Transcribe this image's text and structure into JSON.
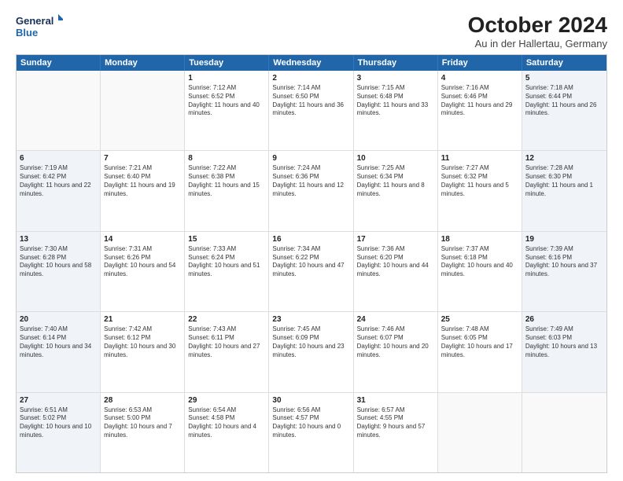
{
  "header": {
    "logo_line1": "General",
    "logo_line2": "Blue",
    "month_title": "October 2024",
    "location": "Au in der Hallertau, Germany"
  },
  "days_of_week": [
    "Sunday",
    "Monday",
    "Tuesday",
    "Wednesday",
    "Thursday",
    "Friday",
    "Saturday"
  ],
  "weeks": [
    [
      {
        "day": "",
        "info": "",
        "shaded": false,
        "empty": true
      },
      {
        "day": "",
        "info": "",
        "shaded": false,
        "empty": true
      },
      {
        "day": "1",
        "info": "Sunrise: 7:12 AM\nSunset: 6:52 PM\nDaylight: 11 hours and 40 minutes.",
        "shaded": false,
        "empty": false
      },
      {
        "day": "2",
        "info": "Sunrise: 7:14 AM\nSunset: 6:50 PM\nDaylight: 11 hours and 36 minutes.",
        "shaded": false,
        "empty": false
      },
      {
        "day": "3",
        "info": "Sunrise: 7:15 AM\nSunset: 6:48 PM\nDaylight: 11 hours and 33 minutes.",
        "shaded": false,
        "empty": false
      },
      {
        "day": "4",
        "info": "Sunrise: 7:16 AM\nSunset: 6:46 PM\nDaylight: 11 hours and 29 minutes.",
        "shaded": false,
        "empty": false
      },
      {
        "day": "5",
        "info": "Sunrise: 7:18 AM\nSunset: 6:44 PM\nDaylight: 11 hours and 26 minutes.",
        "shaded": true,
        "empty": false
      }
    ],
    [
      {
        "day": "6",
        "info": "Sunrise: 7:19 AM\nSunset: 6:42 PM\nDaylight: 11 hours and 22 minutes.",
        "shaded": true,
        "empty": false
      },
      {
        "day": "7",
        "info": "Sunrise: 7:21 AM\nSunset: 6:40 PM\nDaylight: 11 hours and 19 minutes.",
        "shaded": false,
        "empty": false
      },
      {
        "day": "8",
        "info": "Sunrise: 7:22 AM\nSunset: 6:38 PM\nDaylight: 11 hours and 15 minutes.",
        "shaded": false,
        "empty": false
      },
      {
        "day": "9",
        "info": "Sunrise: 7:24 AM\nSunset: 6:36 PM\nDaylight: 11 hours and 12 minutes.",
        "shaded": false,
        "empty": false
      },
      {
        "day": "10",
        "info": "Sunrise: 7:25 AM\nSunset: 6:34 PM\nDaylight: 11 hours and 8 minutes.",
        "shaded": false,
        "empty": false
      },
      {
        "day": "11",
        "info": "Sunrise: 7:27 AM\nSunset: 6:32 PM\nDaylight: 11 hours and 5 minutes.",
        "shaded": false,
        "empty": false
      },
      {
        "day": "12",
        "info": "Sunrise: 7:28 AM\nSunset: 6:30 PM\nDaylight: 11 hours and 1 minute.",
        "shaded": true,
        "empty": false
      }
    ],
    [
      {
        "day": "13",
        "info": "Sunrise: 7:30 AM\nSunset: 6:28 PM\nDaylight: 10 hours and 58 minutes.",
        "shaded": true,
        "empty": false
      },
      {
        "day": "14",
        "info": "Sunrise: 7:31 AM\nSunset: 6:26 PM\nDaylight: 10 hours and 54 minutes.",
        "shaded": false,
        "empty": false
      },
      {
        "day": "15",
        "info": "Sunrise: 7:33 AM\nSunset: 6:24 PM\nDaylight: 10 hours and 51 minutes.",
        "shaded": false,
        "empty": false
      },
      {
        "day": "16",
        "info": "Sunrise: 7:34 AM\nSunset: 6:22 PM\nDaylight: 10 hours and 47 minutes.",
        "shaded": false,
        "empty": false
      },
      {
        "day": "17",
        "info": "Sunrise: 7:36 AM\nSunset: 6:20 PM\nDaylight: 10 hours and 44 minutes.",
        "shaded": false,
        "empty": false
      },
      {
        "day": "18",
        "info": "Sunrise: 7:37 AM\nSunset: 6:18 PM\nDaylight: 10 hours and 40 minutes.",
        "shaded": false,
        "empty": false
      },
      {
        "day": "19",
        "info": "Sunrise: 7:39 AM\nSunset: 6:16 PM\nDaylight: 10 hours and 37 minutes.",
        "shaded": true,
        "empty": false
      }
    ],
    [
      {
        "day": "20",
        "info": "Sunrise: 7:40 AM\nSunset: 6:14 PM\nDaylight: 10 hours and 34 minutes.",
        "shaded": true,
        "empty": false
      },
      {
        "day": "21",
        "info": "Sunrise: 7:42 AM\nSunset: 6:12 PM\nDaylight: 10 hours and 30 minutes.",
        "shaded": false,
        "empty": false
      },
      {
        "day": "22",
        "info": "Sunrise: 7:43 AM\nSunset: 6:11 PM\nDaylight: 10 hours and 27 minutes.",
        "shaded": false,
        "empty": false
      },
      {
        "day": "23",
        "info": "Sunrise: 7:45 AM\nSunset: 6:09 PM\nDaylight: 10 hours and 23 minutes.",
        "shaded": false,
        "empty": false
      },
      {
        "day": "24",
        "info": "Sunrise: 7:46 AM\nSunset: 6:07 PM\nDaylight: 10 hours and 20 minutes.",
        "shaded": false,
        "empty": false
      },
      {
        "day": "25",
        "info": "Sunrise: 7:48 AM\nSunset: 6:05 PM\nDaylight: 10 hours and 17 minutes.",
        "shaded": false,
        "empty": false
      },
      {
        "day": "26",
        "info": "Sunrise: 7:49 AM\nSunset: 6:03 PM\nDaylight: 10 hours and 13 minutes.",
        "shaded": true,
        "empty": false
      }
    ],
    [
      {
        "day": "27",
        "info": "Sunrise: 6:51 AM\nSunset: 5:02 PM\nDaylight: 10 hours and 10 minutes.",
        "shaded": true,
        "empty": false
      },
      {
        "day": "28",
        "info": "Sunrise: 6:53 AM\nSunset: 5:00 PM\nDaylight: 10 hours and 7 minutes.",
        "shaded": false,
        "empty": false
      },
      {
        "day": "29",
        "info": "Sunrise: 6:54 AM\nSunset: 4:58 PM\nDaylight: 10 hours and 4 minutes.",
        "shaded": false,
        "empty": false
      },
      {
        "day": "30",
        "info": "Sunrise: 6:56 AM\nSunset: 4:57 PM\nDaylight: 10 hours and 0 minutes.",
        "shaded": false,
        "empty": false
      },
      {
        "day": "31",
        "info": "Sunrise: 6:57 AM\nSunset: 4:55 PM\nDaylight: 9 hours and 57 minutes.",
        "shaded": false,
        "empty": false
      },
      {
        "day": "",
        "info": "",
        "shaded": false,
        "empty": true
      },
      {
        "day": "",
        "info": "",
        "shaded": true,
        "empty": true
      }
    ]
  ]
}
